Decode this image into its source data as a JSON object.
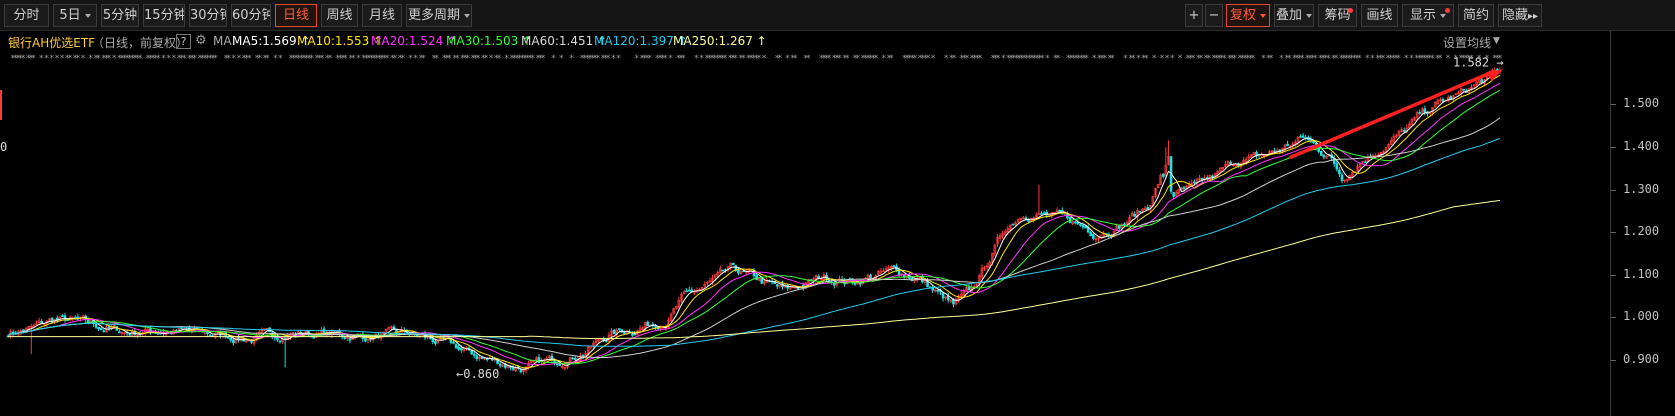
{
  "toolbar": {
    "buttons_left": [
      {
        "label": "分时",
        "key": "fenshi"
      },
      {
        "label": "5日",
        "key": "5day",
        "dropdown": true
      },
      {
        "label": "5分钟",
        "key": "5min"
      },
      {
        "label": "15分钟",
        "key": "15min"
      },
      {
        "label": "30分钟",
        "key": "30min"
      },
      {
        "label": "60分钟",
        "key": "60min"
      },
      {
        "label": "日线",
        "key": "daily",
        "active": true
      },
      {
        "label": "周线",
        "key": "weekly"
      },
      {
        "label": "月线",
        "key": "monthly"
      },
      {
        "label": "更多周期",
        "key": "more-periods",
        "dropdown": true
      }
    ],
    "buttons_right": [
      {
        "label": "+",
        "key": "zoom-in"
      },
      {
        "label": "−",
        "key": "zoom-out"
      },
      {
        "label": "复权",
        "key": "fuquan",
        "dropdown": true,
        "active": true
      },
      {
        "label": "叠加",
        "key": "overlay",
        "dropdown": true
      },
      {
        "label": "筹码",
        "key": "chips",
        "dot": true
      },
      {
        "label": "画线",
        "key": "draw-line"
      },
      {
        "label": "显示",
        "key": "display",
        "dropdown": true,
        "dot": true
      },
      {
        "label": "简约",
        "key": "simple"
      },
      {
        "label": "隐藏",
        "key": "hide",
        "arrows": "▸▸"
      }
    ]
  },
  "info": {
    "name": "银行AH优选ETF",
    "mode": "（日线，前复权）",
    "help": "?",
    "ma_label": "MA",
    "settings_label": "设置均线",
    "ma": [
      {
        "label": "MA5:1.569",
        "color": "#ffffff"
      },
      {
        "label": "MA10:1.553",
        "color": "#ffe600"
      },
      {
        "label": "MA20:1.524",
        "color": "#ff33ff"
      },
      {
        "label": "MA30:1.503",
        "color": "#33ff33"
      },
      {
        "label": "MA60:1.451",
        "color": "#d8d8d8"
      },
      {
        "label": "MA120:1.397",
        "color": "#22ccee"
      },
      {
        "label": "MA250:1.267",
        "color": "#ffff99"
      }
    ]
  },
  "axis": {
    "ticks": [
      "1.500",
      "1.400",
      "1.300",
      "1.200",
      "1.100",
      "1.000",
      "0.900"
    ],
    "partial_left_label": "0"
  },
  "annotations": {
    "high_label": "1.582",
    "low_label": "0.860",
    "trend_arrow_color": "#ff2020"
  },
  "chart_data": {
    "type": "candlestick",
    "period": "daily",
    "ylim": [
      0.865,
      1.585
    ],
    "x_range_sessions": [
      0,
      500
    ],
    "recent_high": 1.582,
    "period_low": 0.86,
    "close_path": [
      [
        0,
        0.965
      ],
      [
        10,
        0.975
      ],
      [
        18,
        0.995
      ],
      [
        30,
        0.985
      ],
      [
        45,
        0.965
      ],
      [
        60,
        0.97
      ],
      [
        80,
        0.96
      ],
      [
        95,
        0.95
      ],
      [
        110,
        0.965
      ],
      [
        125,
        0.96
      ],
      [
        140,
        0.955
      ],
      [
        155,
        0.96
      ],
      [
        168,
        0.94
      ],
      [
        178,
        0.915
      ],
      [
        186,
        0.9
      ],
      [
        200,
        0.88
      ],
      [
        212,
        0.9
      ],
      [
        222,
        0.92
      ],
      [
        232,
        0.96
      ],
      [
        245,
        0.98
      ],
      [
        255,
        1.0
      ],
      [
        260,
        1.04
      ],
      [
        280,
        1.11
      ],
      [
        300,
        1.06
      ],
      [
        315,
        1.095
      ],
      [
        326,
        1.085
      ],
      [
        336,
        1.1
      ],
      [
        343,
        1.11
      ],
      [
        352,
        1.09
      ],
      [
        358,
        1.06
      ],
      [
        365,
        1.025
      ],
      [
        372,
        1.06
      ],
      [
        380,
        1.15
      ],
      [
        385,
        1.21
      ],
      [
        392,
        1.25
      ],
      [
        400,
        1.24
      ],
      [
        410,
        1.225
      ],
      [
        420,
        1.2
      ],
      [
        430,
        1.22
      ],
      [
        440,
        1.26
      ],
      [
        445,
        1.33
      ],
      [
        450,
        1.29
      ],
      [
        458,
        1.3
      ],
      [
        466,
        1.33
      ],
      [
        475,
        1.37
      ],
      [
        480,
        1.37
      ],
      [
        490,
        1.39
      ],
      [
        500,
        1.42
      ],
      [
        510,
        1.38
      ],
      [
        515,
        1.33
      ],
      [
        522,
        1.37
      ],
      [
        530,
        1.4
      ],
      [
        538,
        1.43
      ],
      [
        545,
        1.47
      ],
      [
        552,
        1.5
      ],
      [
        560,
        1.52
      ],
      [
        568,
        1.55
      ],
      [
        576,
        1.575
      ]
    ],
    "moving_averages": [
      {
        "name": "MA5",
        "value": 1.569
      },
      {
        "name": "MA10",
        "value": 1.553
      },
      {
        "name": "MA20",
        "value": 1.524
      },
      {
        "name": "MA30",
        "value": 1.503
      },
      {
        "name": "MA60",
        "value": 1.451
      },
      {
        "name": "MA120",
        "value": 1.397
      },
      {
        "name": "MA250",
        "value": 1.267
      }
    ],
    "grid": false
  }
}
